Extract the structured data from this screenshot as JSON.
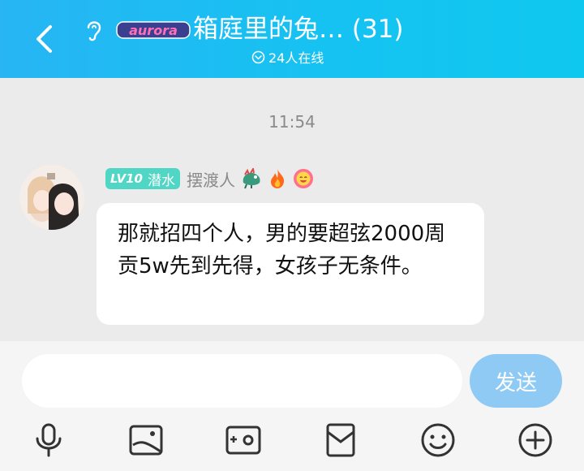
{
  "header": {
    "group_name": "箱庭里的兔… (31)",
    "logo_text": "aurora",
    "online_text": "24人在线"
  },
  "chat": {
    "timestamp": "11:54",
    "message": {
      "badge_level": "LV10",
      "badge_title": "潜水",
      "sender": "摆渡人",
      "text": "那就招四个人，男的要超弦2000周贡5w先到先得，女孩子无条件。"
    }
  },
  "composer": {
    "placeholder": "",
    "send_label": "发送"
  },
  "toolbar": {
    "icons": [
      "microphone-icon",
      "image-icon",
      "camera-icon",
      "red-packet-icon",
      "emoji-icon",
      "plus-icon"
    ]
  },
  "colors": {
    "header": "#1ec0f2",
    "send_button": "#8fcaf5",
    "badge": "#4fd6c4"
  }
}
